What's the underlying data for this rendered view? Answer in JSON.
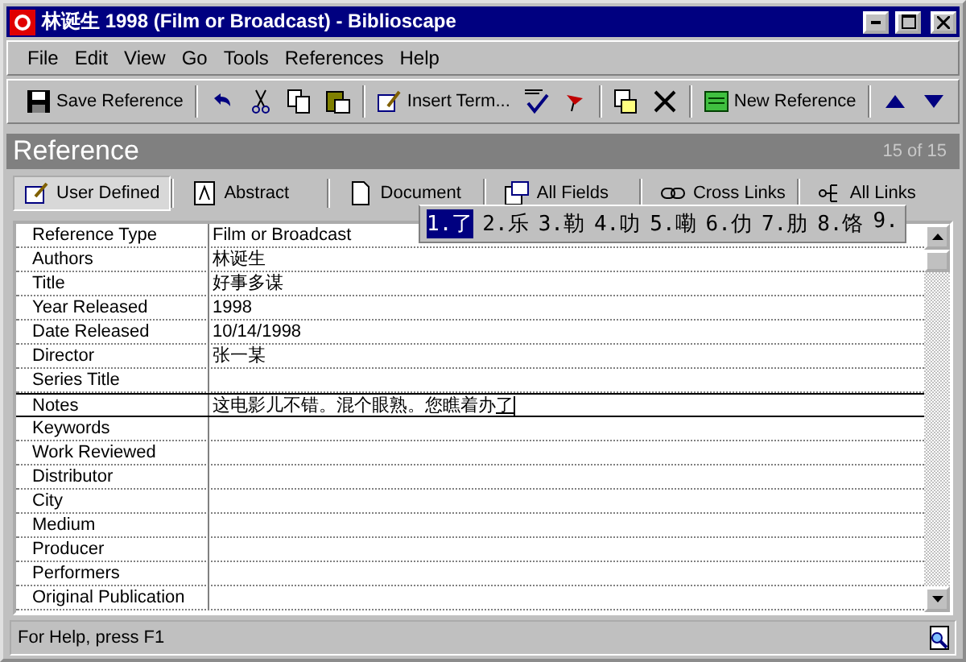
{
  "window": {
    "title": "林诞生 1998  (Film or Broadcast) - Biblioscape"
  },
  "menu": [
    "File",
    "Edit",
    "View",
    "Go",
    "Tools",
    "References",
    "Help"
  ],
  "toolbar": [
    {
      "kind": "text",
      "label": "Save Reference"
    },
    {
      "kind": "sep"
    },
    {
      "kind": "icon"
    },
    {
      "kind": "icon"
    },
    {
      "kind": "icon"
    },
    {
      "kind": "icon"
    },
    {
      "kind": "sep"
    },
    {
      "kind": "text",
      "label": "Insert Term..."
    },
    {
      "kind": "icon"
    },
    {
      "kind": "icon"
    },
    {
      "kind": "sep"
    },
    {
      "kind": "icon"
    },
    {
      "kind": "icon"
    },
    {
      "kind": "sep"
    },
    {
      "kind": "text",
      "label": "New Reference"
    },
    {
      "kind": "sep"
    },
    {
      "kind": "icon"
    },
    {
      "kind": "icon"
    }
  ],
  "header": {
    "title": "Reference",
    "count": "15 of 15"
  },
  "tabs": [
    {
      "label": "User Defined",
      "selected": true
    },
    {
      "label": "Abstract",
      "selected": false
    },
    {
      "label": "Document",
      "selected": false
    },
    {
      "label": "All Fields",
      "selected": false
    },
    {
      "label": "Cross Links",
      "selected": false
    },
    {
      "label": "All Links",
      "selected": false
    }
  ],
  "fields": [
    {
      "name": "Reference Type",
      "value": "Film or Broadcast"
    },
    {
      "name": "Authors",
      "value": "林诞生"
    },
    {
      "name": "Title",
      "value": "好事多谋"
    },
    {
      "name": "Year Released",
      "value": "1998"
    },
    {
      "name": "Date Released",
      "value": "10/14/1998"
    },
    {
      "name": "Director",
      "value": "张一某"
    },
    {
      "name": "Series Title"
    },
    {
      "name": "Notes",
      "value": "这电影儿不错。混个眼熟。您瞧着办",
      "composition": "了",
      "editing": true
    },
    {
      "name": "Keywords"
    },
    {
      "name": "Work Reviewed"
    },
    {
      "name": "Distributor"
    },
    {
      "name": "City"
    },
    {
      "name": "Medium"
    },
    {
      "name": "Producer"
    },
    {
      "name": "Performers"
    },
    {
      "name": "Original Publication"
    }
  ],
  "candidates": [
    {
      "label": "1.了",
      "selected": true
    },
    {
      "label": "2.乐",
      "selected": false
    },
    {
      "label": "3.勒",
      "selected": false
    },
    {
      "label": "4.叻",
      "selected": false
    },
    {
      "label": "5.嘞",
      "selected": false
    },
    {
      "label": "6.仂",
      "selected": false
    },
    {
      "label": "7.肋",
      "selected": false
    },
    {
      "label": "8.饹",
      "selected": false
    },
    {
      "label": "9.",
      "selected": false
    }
  ],
  "status_bar": {
    "text": "For Help, press F1"
  }
}
